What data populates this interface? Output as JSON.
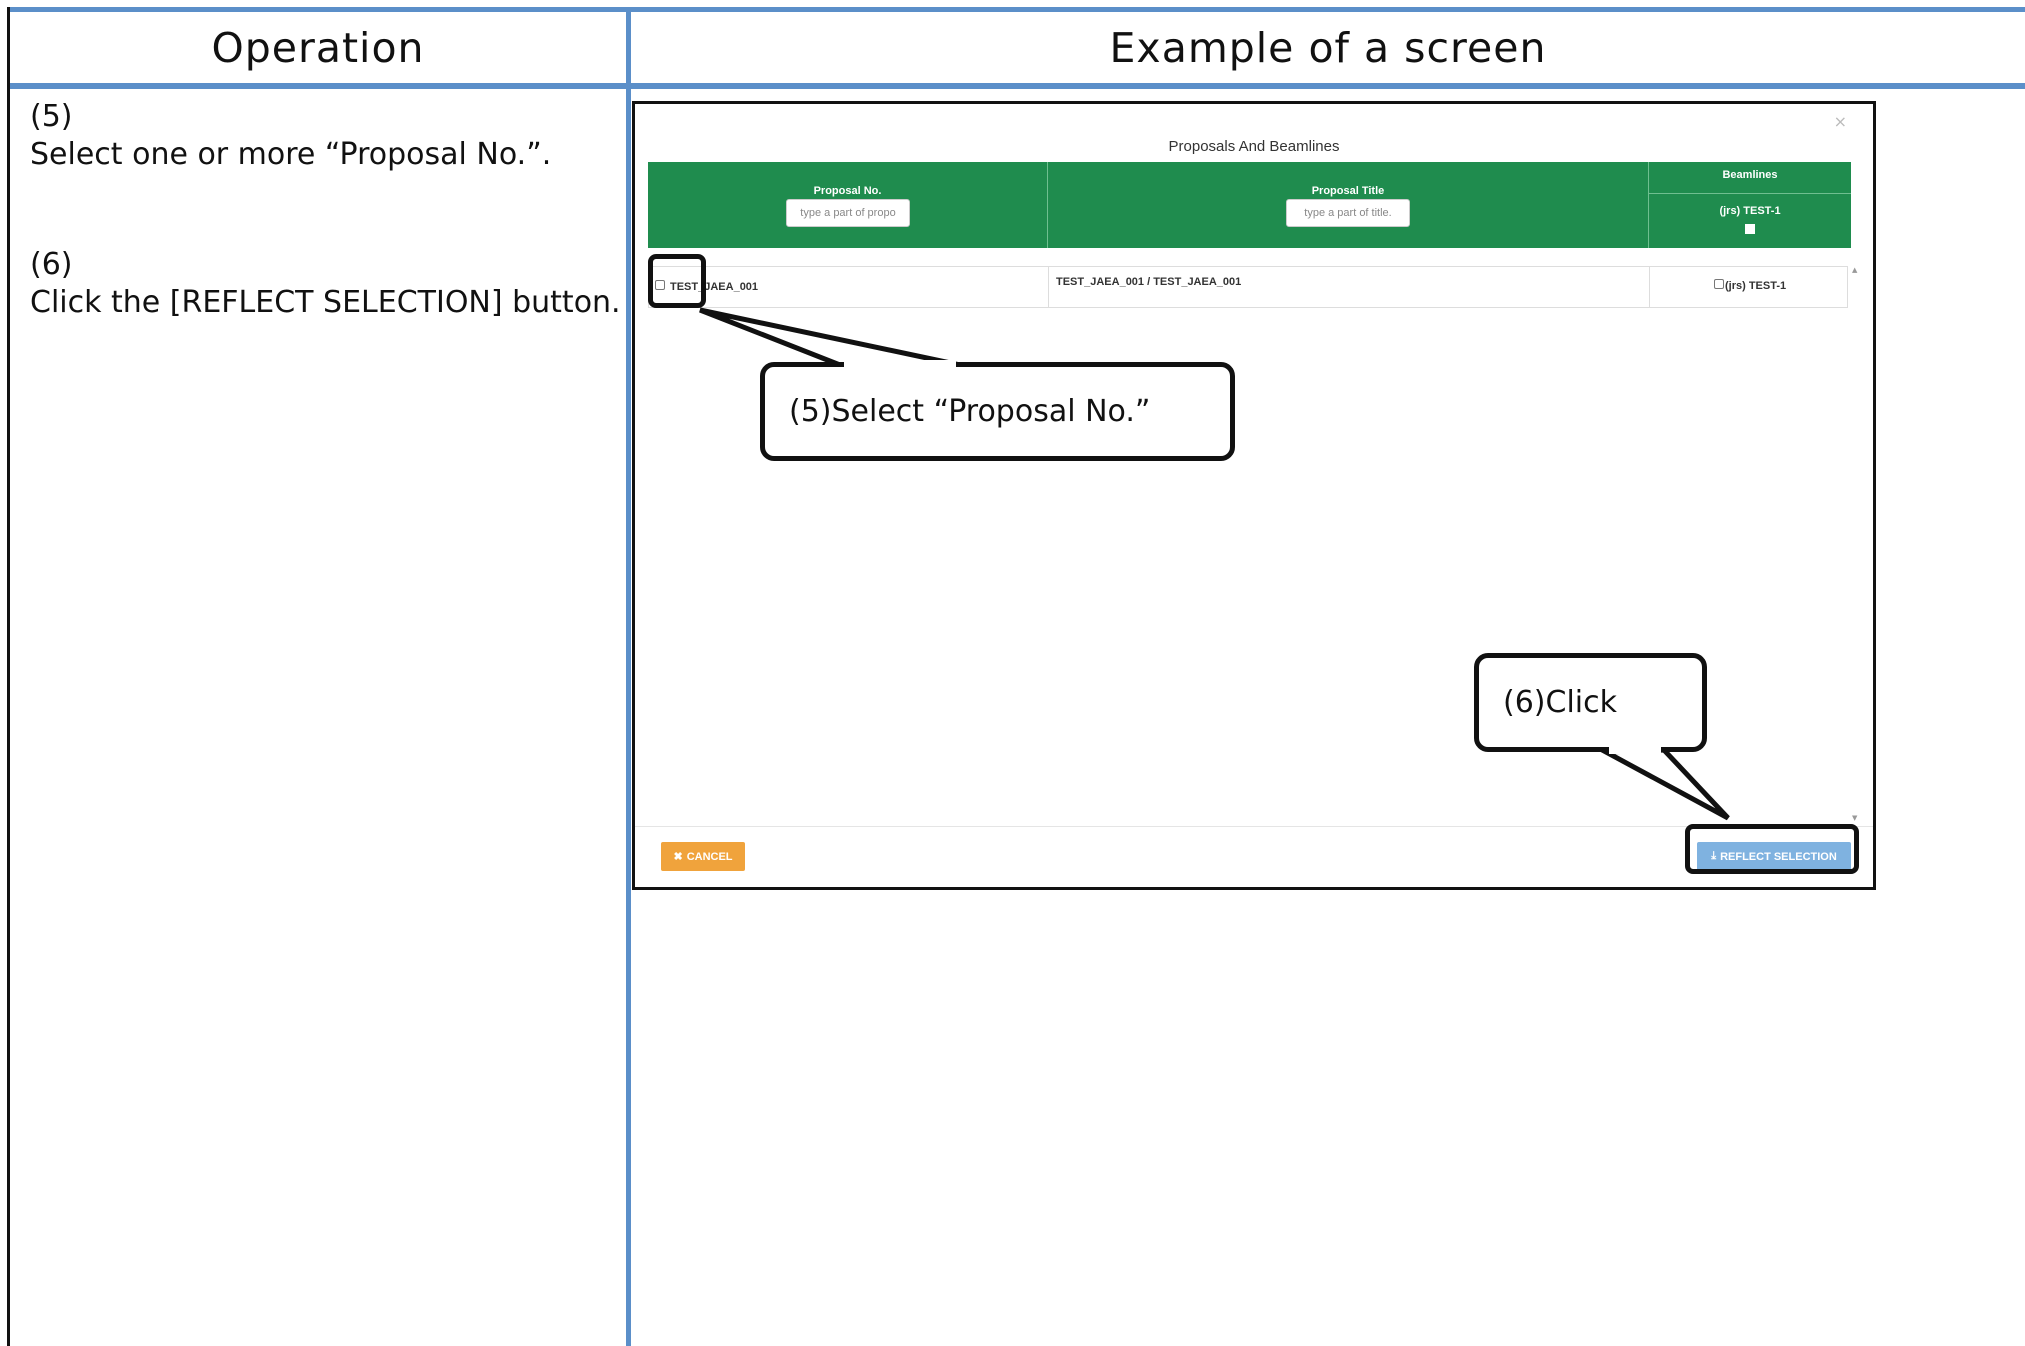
{
  "header": {
    "operation": "Operation",
    "example": "Example of a screen"
  },
  "steps": [
    {
      "number": "(5)",
      "text": "Select one or more “Proposal No.”."
    },
    {
      "number": "(6)",
      "text": "Click the [REFLECT SELECTION] button."
    }
  ],
  "modal": {
    "close": "×",
    "title": "Proposals And Beamlines",
    "columns": {
      "proposal_no": "Proposal No.",
      "proposal_no_placeholder": "type a part of propo",
      "proposal_title": "Proposal Title",
      "proposal_title_placeholder": "type a part of title.",
      "beamlines": "Beamlines",
      "beamline_sub": "(jrs) TEST-1"
    },
    "rows": [
      {
        "proposal_no": "TEST_JAEA_001",
        "proposal_title": "TEST_JAEA_001 / TEST_JAEA_001",
        "beamline": "(jrs) TEST-1"
      }
    ],
    "cancel_label": "CANCEL",
    "cancel_icon": "close-icon",
    "reflect_label": "REFLECT SELECTION",
    "reflect_icon": "download-icon"
  },
  "callouts": {
    "select": "(5)Select “Proposal No.”",
    "click": "(6)Click"
  },
  "colors": {
    "rule_blue": "#5b8fc9",
    "table_header_green": "#1f8c4e",
    "cancel_orange": "#f0a33c",
    "reflect_blue": "#7fb2e0"
  }
}
